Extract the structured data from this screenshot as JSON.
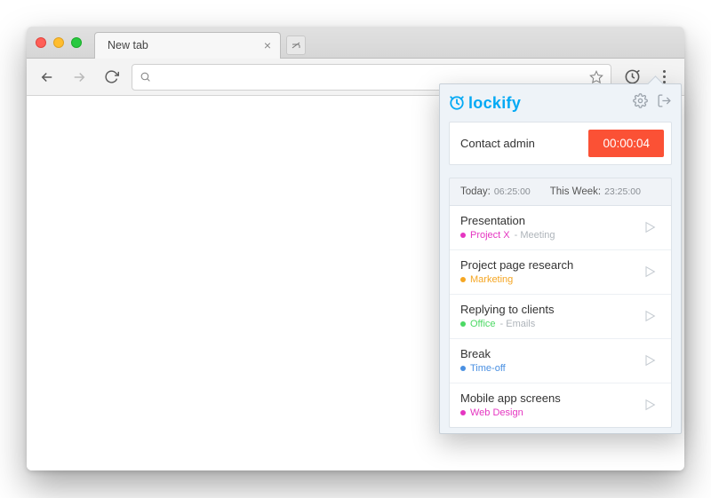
{
  "browser": {
    "tab_title": "New tab",
    "omnibox_value": ""
  },
  "popup": {
    "brand": "lockify",
    "current": {
      "task": "Contact admin",
      "timer": "00:00:04"
    },
    "summary": {
      "today_label": "Today:",
      "today_value": "06:25:00",
      "week_label": "This Week:",
      "week_value": "23:25:00"
    },
    "entries": [
      {
        "title": "Presentation",
        "project": "Project X",
        "sub": "Meeting",
        "color": "#e535c1"
      },
      {
        "title": "Project page research",
        "project": "Marketing",
        "sub": "",
        "color": "#f5a623"
      },
      {
        "title": "Replying to clients",
        "project": "Office",
        "sub": "Emails",
        "color": "#4cd964"
      },
      {
        "title": "Break",
        "project": "Time-off",
        "sub": "",
        "color": "#4a90e2"
      },
      {
        "title": "Mobile app screens",
        "project": "Web Design",
        "sub": "",
        "color": "#e535c1"
      }
    ]
  }
}
